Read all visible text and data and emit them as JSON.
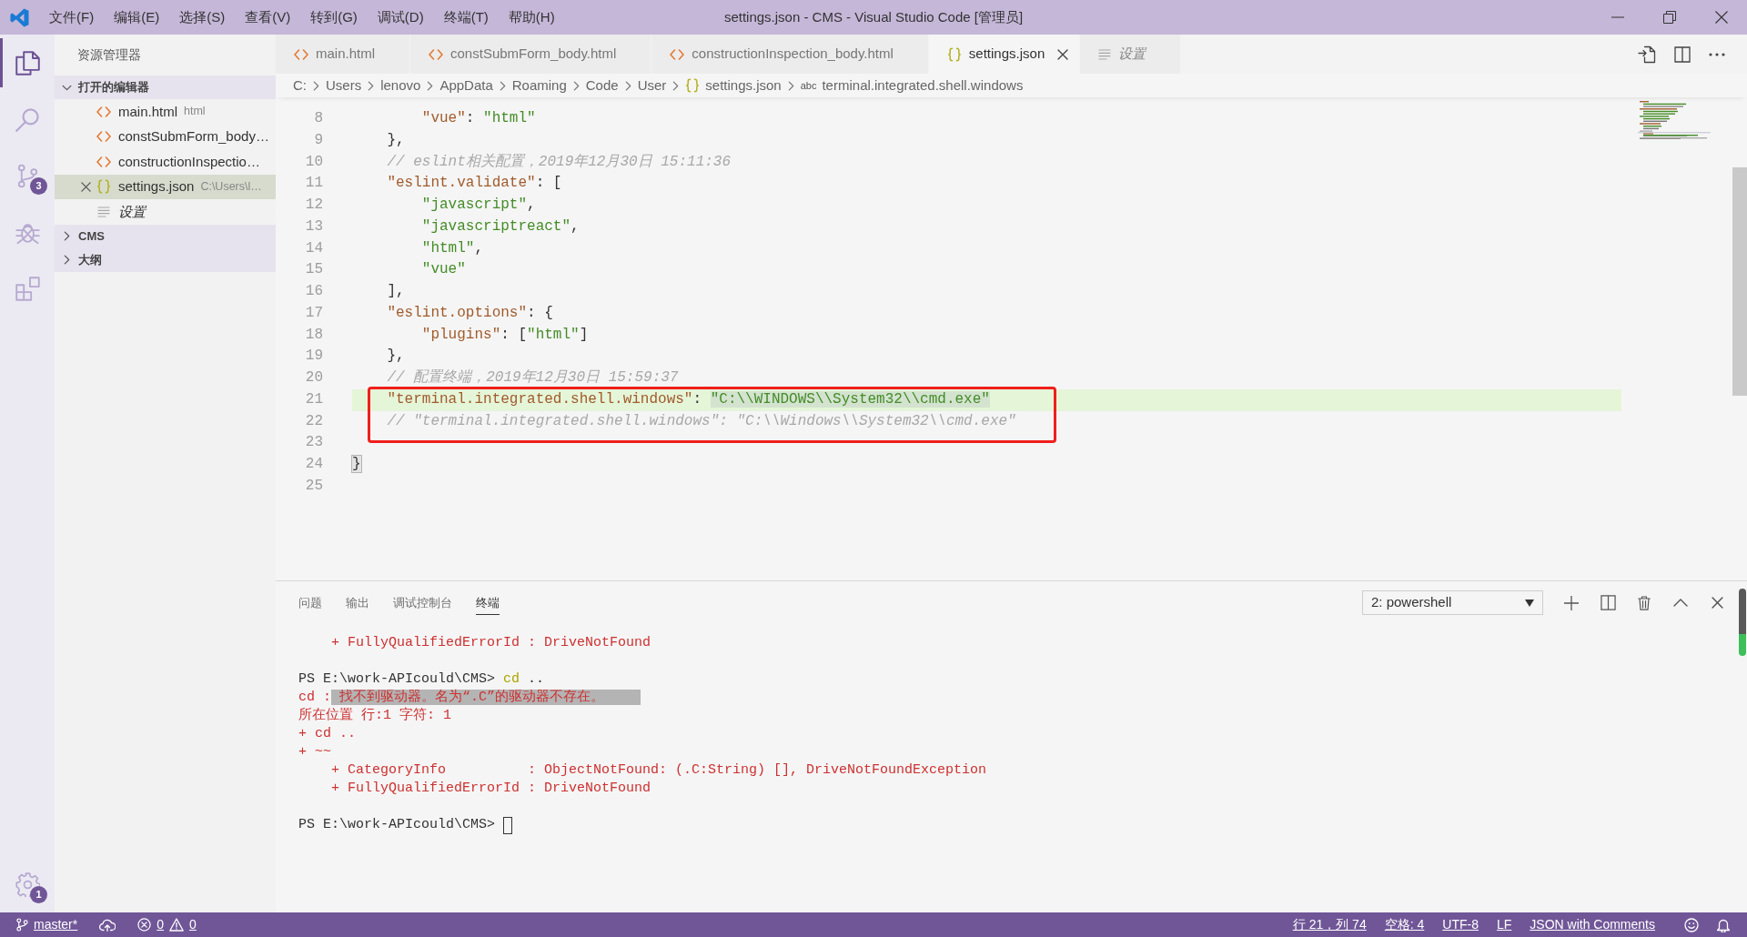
{
  "window": {
    "title": "settings.json - CMS - Visual Studio Code [管理员]"
  },
  "menu": [
    "文件(F)",
    "编辑(E)",
    "选择(S)",
    "查看(V)",
    "转到(G)",
    "调试(D)",
    "终端(T)",
    "帮助(H)"
  ],
  "activity_bar": {
    "items": [
      {
        "kind": "explorer",
        "selected": true
      },
      {
        "kind": "search",
        "selected": false
      },
      {
        "kind": "source-control",
        "selected": false,
        "badge": "3"
      },
      {
        "kind": "debug",
        "selected": false
      },
      {
        "kind": "extensions",
        "selected": false
      }
    ],
    "manage": {
      "badge": "1"
    }
  },
  "sidebar": {
    "title": "资源管理器",
    "sections": [
      {
        "title": "打开的编辑器",
        "expanded": true,
        "items": [
          {
            "kind": "html",
            "name": "main.html",
            "description": "html",
            "selected": false,
            "preview": false
          },
          {
            "kind": "html",
            "name": "constSubmForm_body…",
            "selected": false,
            "preview": false
          },
          {
            "kind": "html",
            "name": "constructionInspectio…",
            "selected": false,
            "preview": false
          },
          {
            "kind": "json",
            "name": "settings.json",
            "description": "C:\\Users\\l…",
            "selected": true,
            "preview": false
          },
          {
            "kind": "settings",
            "name": "设置",
            "selected": false,
            "preview": true
          }
        ]
      },
      {
        "title": "CMS",
        "expanded": false
      },
      {
        "title": "大纲",
        "expanded": false
      }
    ]
  },
  "tabs": [
    {
      "kind": "html",
      "label": "main.html",
      "selected": false,
      "preview": false
    },
    {
      "kind": "html",
      "label": "constSubmForm_body.html",
      "selected": false,
      "preview": false
    },
    {
      "kind": "html",
      "label": "constructionInspection_body.html",
      "selected": false,
      "preview": false
    },
    {
      "kind": "json",
      "label": "settings.json",
      "selected": true,
      "preview": false
    },
    {
      "kind": "settings",
      "label": "设置",
      "selected": false,
      "preview": true
    }
  ],
  "editor_actions": [
    {
      "kind": "open-file"
    },
    {
      "kind": "split"
    },
    {
      "kind": "more"
    }
  ],
  "breadcrumbs": [
    {
      "kind": "folder",
      "label": "C:"
    },
    {
      "kind": "folder",
      "label": "Users"
    },
    {
      "kind": "folder",
      "label": "lenovo"
    },
    {
      "kind": "folder",
      "label": "AppData"
    },
    {
      "kind": "folder",
      "label": "Roaming"
    },
    {
      "kind": "folder",
      "label": "Code"
    },
    {
      "kind": "folder",
      "label": "User"
    },
    {
      "kind": "json",
      "label": "settings.json"
    },
    {
      "kind": "property",
      "symbol": "abc",
      "label": "terminal.integrated.shell.windows"
    }
  ],
  "editor": {
    "lines": [
      {
        "children": [
          {
            "children": [
              {
                "number": "8",
                "tokens": [
                  {
                    "kind": "key",
                    "text": "\"vue\""
                  },
                  {
                    "kind": "punct",
                    "text": ": "
                  },
                  {
                    "kind": "string",
                    "text": "\"html\""
                  }
                ],
                "active": false,
                "framed": false
              }
            ]
          },
          {
            "number": "9",
            "tokens": [
              {
                "kind": "punct",
                "text": "},"
              }
            ],
            "active": false,
            "framed": false
          },
          {
            "number": "10",
            "tokens": [
              {
                "kind": "comment",
                "text": "// eslint相关配置，2019年12月30日 15:11:36"
              }
            ],
            "active": false,
            "framed": false
          },
          {
            "number": "11",
            "tokens": [
              {
                "kind": "key",
                "text": "\"eslint.validate\""
              },
              {
                "kind": "punct",
                "text": ": ["
              }
            ],
            "active": false,
            "framed": false,
            "children": [
              {
                "number": "12",
                "tokens": [
                  {
                    "kind": "string",
                    "text": "\"javascript\""
                  },
                  {
                    "kind": "punct",
                    "text": ","
                  }
                ],
                "active": false,
                "framed": false
              },
              {
                "number": "13",
                "tokens": [
                  {
                    "kind": "string",
                    "text": "\"javascriptreact\""
                  },
                  {
                    "kind": "punct",
                    "text": ","
                  }
                ],
                "active": false,
                "framed": false
              },
              {
                "number": "14",
                "tokens": [
                  {
                    "kind": "string",
                    "text": "\"html\""
                  },
                  {
                    "kind": "punct",
                    "text": ","
                  }
                ],
                "active": false,
                "framed": false
              },
              {
                "number": "15",
                "tokens": [
                  {
                    "kind": "string",
                    "text": "\"vue\""
                  }
                ],
                "active": false,
                "framed": false
              }
            ]
          },
          {
            "number": "16",
            "tokens": [
              {
                "kind": "punct",
                "text": "],"
              }
            ],
            "active": false,
            "framed": false
          },
          {
            "number": "17",
            "tokens": [
              {
                "kind": "key",
                "text": "\"eslint.options\""
              },
              {
                "kind": "punct",
                "text": ": {"
              }
            ],
            "active": false,
            "framed": false,
            "children": [
              {
                "number": "18",
                "tokens": [
                  {
                    "kind": "key",
                    "text": "\"plugins\""
                  },
                  {
                    "kind": "punct",
                    "text": ": ["
                  },
                  {
                    "kind": "string",
                    "text": "\"html\""
                  },
                  {
                    "kind": "punct",
                    "text": "]"
                  }
                ],
                "active": false,
                "framed": false
              }
            ]
          },
          {
            "number": "19",
            "tokens": [
              {
                "kind": "punct",
                "text": "},"
              }
            ],
            "active": false,
            "framed": false
          },
          {
            "number": "20",
            "tokens": [
              {
                "kind": "comment",
                "text": "// 配置终端，2019年12月30日 15:59:37"
              }
            ],
            "active": false,
            "framed": false
          },
          {
            "number": "21",
            "tokens": [
              {
                "kind": "key",
                "text": "\"terminal.integrated.shell.windows\""
              },
              {
                "kind": "punct",
                "text": ": "
              },
              {
                "kind": "string-match",
                "text": "\"C:\\\\WINDOWS\\\\System32\\\\cmd.exe\""
              }
            ],
            "active": true,
            "framed": true
          },
          {
            "number": "22",
            "tokens": [
              {
                "kind": "comment",
                "text": "// \"terminal.integrated.shell.windows\": \"C:\\\\Windows\\\\System32\\\\cmd.exe\""
              }
            ],
            "active": false,
            "framed": true
          },
          {
            "number": "23",
            "active": false,
            "framed": false
          }
        ]
      },
      {
        "number": "24",
        "tokens": [
          {
            "kind": "bracket-match",
            "text": "}"
          }
        ],
        "active": false,
        "framed": false
      },
      {
        "number": "25",
        "active": false,
        "framed": false
      }
    ]
  },
  "panel": {
    "tabs": [
      {
        "label": "问题",
        "selected": false
      },
      {
        "label": "输出",
        "selected": false
      },
      {
        "label": "调试控制台",
        "selected": false
      },
      {
        "label": "终端",
        "selected": true
      }
    ],
    "terminal_select": {
      "value": "2: powershell"
    },
    "actions": [
      {
        "kind": "add"
      },
      {
        "kind": "split"
      },
      {
        "kind": "kill"
      },
      {
        "kind": "maximize"
      },
      {
        "kind": "close"
      }
    ],
    "terminal": [
      {
        "kind": "detail",
        "segments": [
          {
            "kind": "error",
            "text": "+ FullyQualifiedErrorId : DriveNotFound"
          }
        ]
      },
      {
        "kind": "blank"
      },
      {
        "kind": "output",
        "segments": [
          {
            "kind": "prompt",
            "text": "PS E:\\work-APIcould\\CMS> "
          },
          {
            "kind": "command",
            "text": "cd"
          },
          {
            "kind": "prompt",
            "text": " .."
          }
        ]
      },
      {
        "kind": "output",
        "segments": [
          {
            "kind": "error",
            "text": "cd :"
          },
          {
            "kind": "error-selected",
            "text": " 找不到驱动器。名为“.C”的驱动器不存在。"
          }
        ]
      },
      {
        "kind": "output",
        "segments": [
          {
            "kind": "error",
            "text": "所在位置 行:1 字符: 1"
          }
        ]
      },
      {
        "kind": "output",
        "segments": [
          {
            "kind": "error",
            "text": "+ cd .."
          }
        ]
      },
      {
        "kind": "output",
        "segments": [
          {
            "kind": "error",
            "text": "+ ~~"
          }
        ]
      },
      {
        "kind": "detail",
        "segments": [
          {
            "kind": "error",
            "text": "+ CategoryInfo          : ObjectNotFound: (.C:String) [], DriveNotFoundException"
          }
        ]
      },
      {
        "kind": "detail",
        "segments": [
          {
            "kind": "error",
            "text": "+ FullyQualifiedErrorId : DriveNotFound"
          }
        ]
      },
      {
        "kind": "blank"
      },
      {
        "kind": "output",
        "segments": [
          {
            "kind": "prompt",
            "text": "PS E:\\work-APIcould\\CMS>"
          },
          {
            "kind": "cursor"
          }
        ]
      }
    ]
  },
  "status_bar": {
    "left": [
      {
        "kind": "branch",
        "text": "master*"
      },
      {
        "kind": "sync"
      },
      {
        "kind": "problems",
        "errors": "0",
        "warnings": "0"
      }
    ],
    "right": [
      {
        "kind": "text",
        "text": "行 21，列 74"
      },
      {
        "kind": "text",
        "text": "空格: 4"
      },
      {
        "kind": "text",
        "text": "UTF-8"
      },
      {
        "kind": "text",
        "text": "LF"
      },
      {
        "kind": "text",
        "text": "JSON with Comments"
      },
      {
        "kind": "feedback"
      },
      {
        "kind": "notifications"
      }
    ]
  }
}
